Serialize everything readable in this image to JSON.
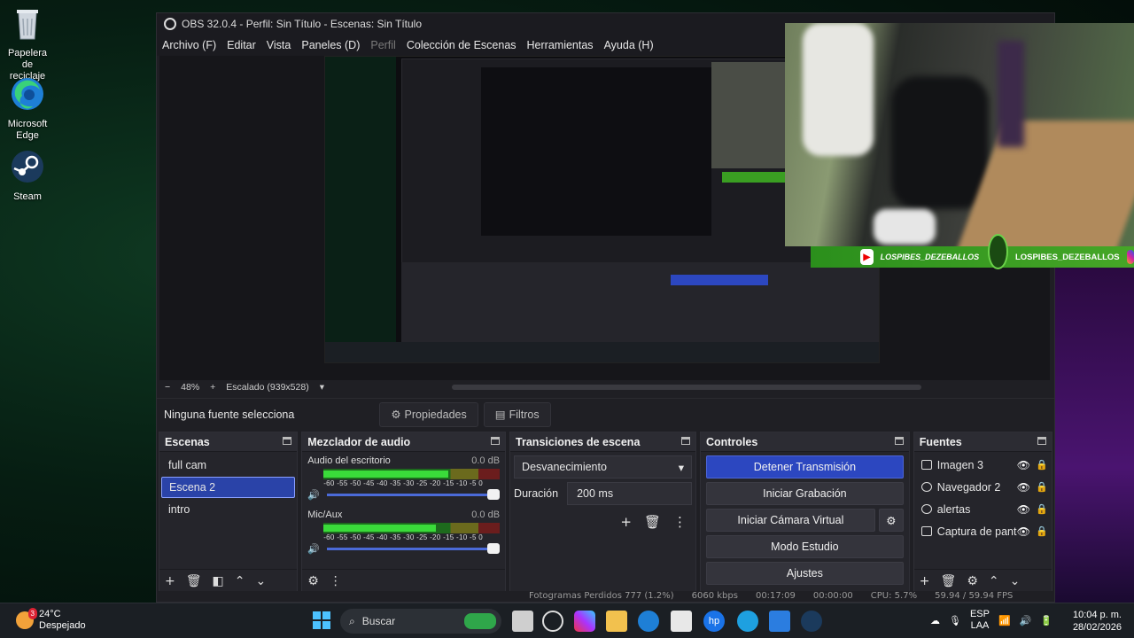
{
  "desktop": {
    "icons": [
      {
        "label_line1": "Papelera de",
        "label_line2": "reciclaje",
        "icon": "recycle-bin-icon"
      },
      {
        "label_line1": "Microsoft",
        "label_line2": "Edge",
        "icon": "edge-icon"
      },
      {
        "label_line1": "Steam",
        "label_line2": "",
        "icon": "steam-icon"
      }
    ]
  },
  "window": {
    "title": "OBS 32.0.4 - Perfil: Sin Título - Escenas: Sin Título",
    "menu": [
      "Archivo (F)",
      "Editar",
      "Vista",
      "Paneles (D)",
      "Perfil",
      "Colección de Escenas",
      "Herramientas",
      "Ayuda (H)"
    ]
  },
  "zoombar": {
    "minus": "−",
    "zoom": "48%",
    "plus": "+",
    "scaling": "Escalado (939x528)",
    "caret": "▾"
  },
  "propbar": {
    "no_source": "Ninguna fuente selecciona",
    "properties": "Propiedades",
    "filters": "Filtros"
  },
  "scenes": {
    "title": "Escenas",
    "items": [
      "full cam",
      "Escena 2",
      "intro"
    ],
    "selected_index": 1
  },
  "mixer": {
    "title": "Mezclador de audio",
    "channels": [
      {
        "name": "Audio del escritorio",
        "db": "0.0 dB",
        "level": 0.71
      },
      {
        "name": "Mic/Aux",
        "db": "0.0 dB",
        "level": 0.64
      }
    ],
    "scale": "-60 -55 -50 -45 -40 -35 -30 -25 -20 -15 -10  -5   0"
  },
  "transitions": {
    "title": "Transiciones de escena",
    "selected": "Desvanecimiento",
    "duration_label": "Duración",
    "duration_value": "200 ms"
  },
  "controls": {
    "title": "Controles",
    "stop_stream": "Detener Transmisión",
    "start_recording": "Iniciar Grabación",
    "virtual_cam": "Iniciar Cámara Virtual",
    "studio_mode": "Modo Estudio",
    "settings": "Ajustes"
  },
  "sources": {
    "title": "Fuentes",
    "items": [
      {
        "name": "Imagen 3",
        "icon": "image-icon"
      },
      {
        "name": "Navegador 2",
        "icon": "browser-icon"
      },
      {
        "name": "alertas",
        "icon": "browser-icon"
      },
      {
        "name": "Captura de pant",
        "icon": "monitor-icon"
      }
    ]
  },
  "statusbar": {
    "dropped": "Fotogramas Perdidos 777 (1.2%)",
    "kbps": "6060 kbps",
    "stream_time": "00:17:09",
    "rec_time": "00:00:00",
    "cpu": "CPU: 5.7%",
    "fps": "59.94 / 59.94 FPS"
  },
  "overlay": {
    "channel1": "LOSPIBES_DEZEBALLOS",
    "channel2": "LOSPIBES_DEZEBALLOS"
  },
  "taskbar": {
    "temp": "24°C",
    "weather": "Despejado",
    "weather_badge": "3",
    "search": "Buscar",
    "lang1": "ESP",
    "lang2": "LAA",
    "time": "10:04 p. m.",
    "date": "28/02/2026"
  },
  "colors": {
    "accent": "#2c47c0",
    "selected_scene": "#2a43a8",
    "overlay_green": "#3a9e22"
  }
}
